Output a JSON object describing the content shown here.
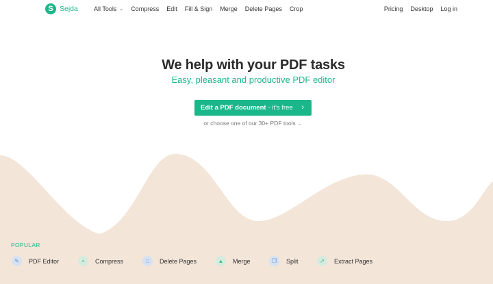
{
  "brand": {
    "logo_letter": "S",
    "name": "Sejda"
  },
  "nav": {
    "left": [
      {
        "label": "All Tools",
        "has_caret": true
      },
      {
        "label": "Compress"
      },
      {
        "label": "Edit"
      },
      {
        "label": "Fill & Sign"
      },
      {
        "label": "Merge"
      },
      {
        "label": "Delete Pages"
      },
      {
        "label": "Crop"
      }
    ],
    "right": [
      {
        "label": "Pricing"
      },
      {
        "label": "Desktop"
      },
      {
        "label": "Log in"
      }
    ]
  },
  "hero": {
    "title": "We help with your PDF tasks",
    "subtitle": "Easy, pleasant and productive PDF editor",
    "cta_bold": "Edit a PDF document",
    "cta_rest": "- it's free",
    "choose_text": "or choose one of our 30+ PDF tools"
  },
  "popular": {
    "heading": "POPULAR",
    "tools": [
      {
        "label": "PDF Editor",
        "icon": "pencil-icon",
        "icon_color": "#5b8fd6",
        "icon_bg": "#d6e2f2"
      },
      {
        "label": "Compress",
        "icon": "compress-icon",
        "icon_color": "#48b884",
        "icon_bg": "#d4ecdf"
      },
      {
        "label": "Delete Pages",
        "icon": "trash-icon",
        "icon_color": "#5b8fd6",
        "icon_bg": "#d6e2f2"
      },
      {
        "label": "Merge",
        "icon": "merge-icon",
        "icon_color": "#48b884",
        "icon_bg": "#d4ecdf"
      },
      {
        "label": "Split",
        "icon": "split-icon",
        "icon_color": "#5b8fd6",
        "icon_bg": "#d6e2f2"
      },
      {
        "label": "Extract Pages",
        "icon": "extract-icon",
        "icon_color": "#48b884",
        "icon_bg": "#d4ecdf"
      }
    ]
  },
  "colors": {
    "accent": "#1bb78b",
    "wave": "#f3e5d8",
    "text": "#333333"
  }
}
